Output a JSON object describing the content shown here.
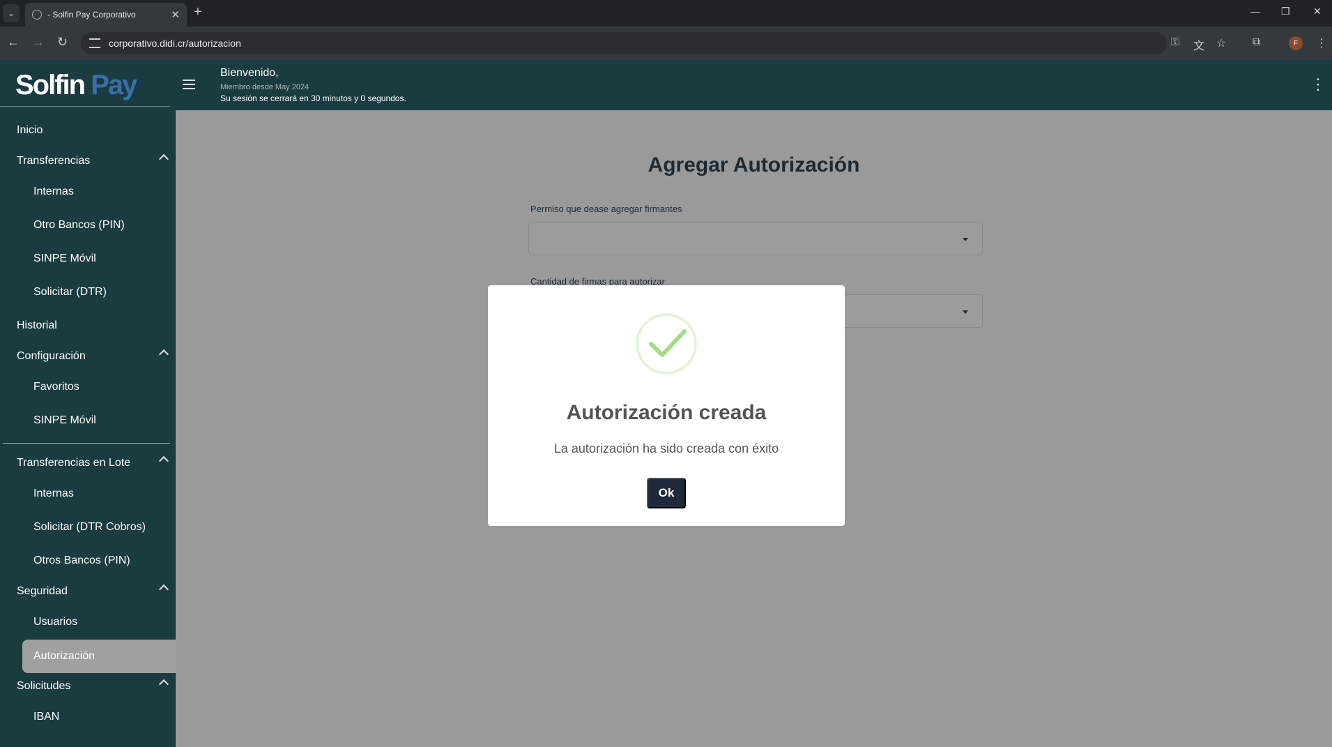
{
  "browser": {
    "tab_title": "- Solfin Pay Corporativo",
    "url": "corporativo.didi.cr/autorizacion",
    "profile_initial": "F"
  },
  "header": {
    "logo_part1": "Solfin",
    "logo_part2": "Pay",
    "welcome": "Bienvenido,",
    "member_since": "Miembro desde May 2024",
    "session_text": "Su sesión se cerrará en 30 minutos y 0 segundos."
  },
  "sidebar": {
    "items": [
      {
        "label": "Inicio"
      },
      {
        "label": "Transferencias"
      },
      {
        "label": "Internas"
      },
      {
        "label": "Otro Bancos (PIN)"
      },
      {
        "label": "SINPE Móvil"
      },
      {
        "label": "Solicitar (DTR)"
      },
      {
        "label": "Historial"
      },
      {
        "label": "Configuración"
      },
      {
        "label": "Favoritos"
      },
      {
        "label": "SINPE Móvil"
      },
      {
        "label": "Transferencias en Lote"
      },
      {
        "label": "Internas"
      },
      {
        "label": "Solicitar (DTR Cobros)"
      },
      {
        "label": "Otros Bancos (PIN)"
      },
      {
        "label": "Seguridad"
      },
      {
        "label": "Usuarios"
      },
      {
        "label": "Autorización"
      },
      {
        "label": "Solicitudes"
      },
      {
        "label": "IBAN"
      }
    ]
  },
  "main": {
    "title": "Agregar Autorización",
    "field1_label": "Permiso que dease agregar firmantes",
    "field1_value": "",
    "field2_label": "Cantidad de firmas para autorizar",
    "field2_value": ""
  },
  "modal": {
    "title": "Autorización creada",
    "text": "La autorización ha sido creada con éxito",
    "ok_label": "Ok"
  },
  "colors": {
    "sidebar_bg": "#1a3b40",
    "overlay_bg": "#9a9a9a",
    "ok_button": "#1e2a3a",
    "success_check": "#a5dc86"
  }
}
